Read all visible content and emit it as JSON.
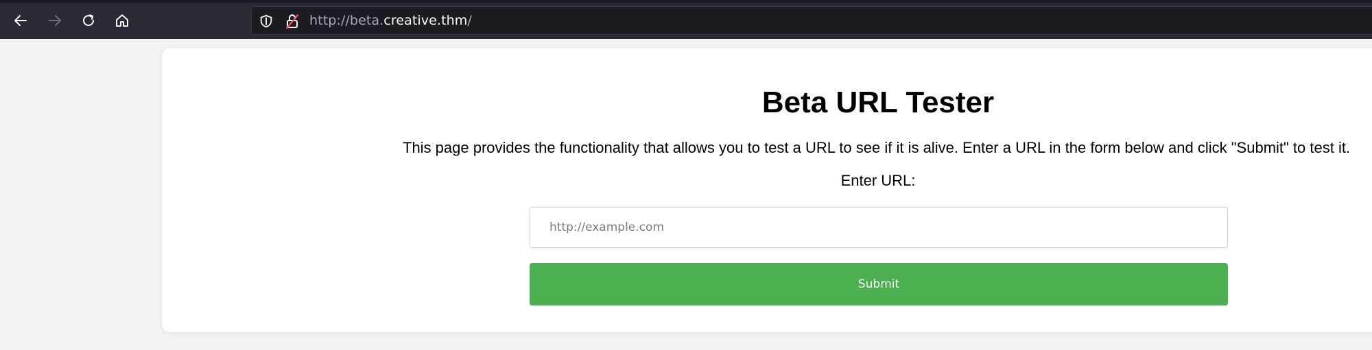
{
  "browser": {
    "url_prefix": "http://beta.",
    "url_host": "creative.thm",
    "url_suffix": "/"
  },
  "page": {
    "title": "Beta URL Tester",
    "description": "This page provides the functionality that allows you to test a URL to see if it is alive. Enter a URL in the form below and click \"Submit\" to test it.",
    "enter_label": "Enter URL:",
    "input": {
      "value": "",
      "placeholder": "http://example.com"
    },
    "submit_label": "Submit"
  },
  "colors": {
    "toolbar_bg": "#2b2a33",
    "urlbar_bg": "#1c1b22",
    "page_bg": "#f2f2f2",
    "button_green": "#4caf50"
  },
  "icons": [
    "back-arrow-icon",
    "forward-arrow-icon",
    "reload-icon",
    "home-icon",
    "shield-icon",
    "insecure-lock-icon"
  ]
}
